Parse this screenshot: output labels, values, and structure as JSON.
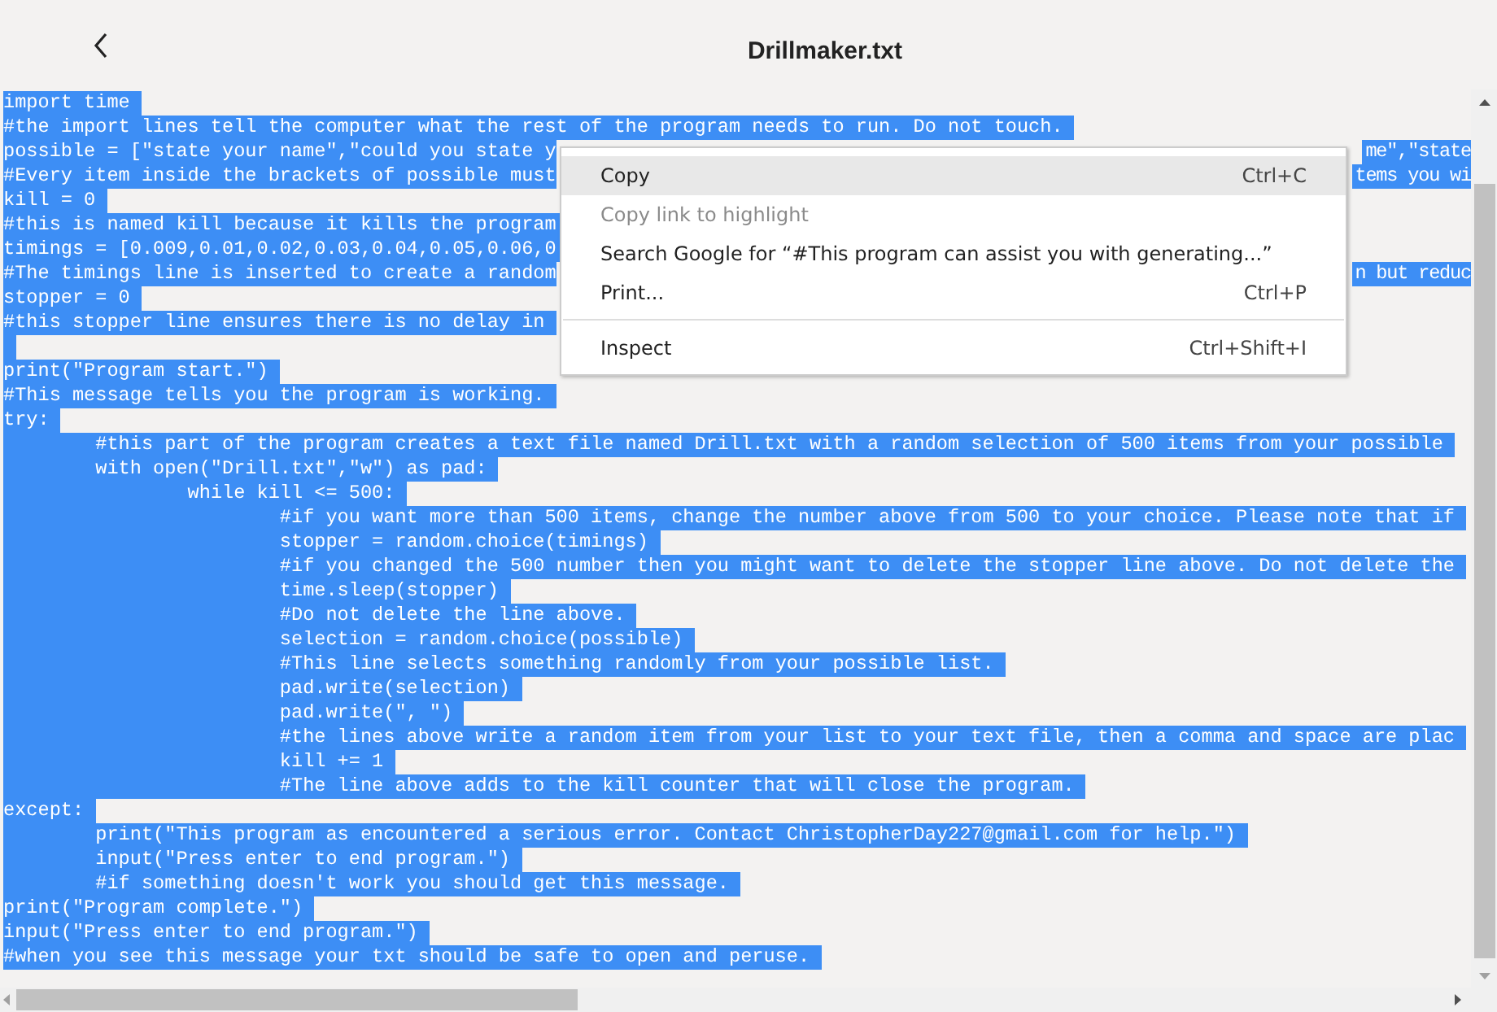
{
  "header": {
    "title": "Drillmaker.txt"
  },
  "lines": [
    {
      "kind": "code",
      "text": "import time",
      "selected": true
    },
    {
      "kind": "code",
      "text": "#the import lines tell the computer what the rest of the program needs to run. Do not touch.",
      "selected": true
    },
    {
      "kind": "code",
      "text": "possible = [\"state your name\",\"could you state y",
      "tail": "me\",\"state",
      "selected": true
    },
    {
      "kind": "code",
      "text": "#Every item inside the brackets of possible must",
      "tail": "tems you wi",
      "selected": true
    },
    {
      "kind": "code",
      "text": "kill = 0",
      "selected": true
    },
    {
      "kind": "code",
      "text": "#this is named kill because it kills the program",
      "selected": true
    },
    {
      "kind": "code",
      "text": "timings = [0.009,0.01,0.02,0.03,0.04,0.05,0.06,0",
      "selected": true
    },
    {
      "kind": "code",
      "text": "#The timings line is inserted to create a random",
      "tail": "n but reduc",
      "selected": true
    },
    {
      "kind": "code",
      "text": "stopper = 0",
      "selected": true
    },
    {
      "kind": "code",
      "text": "#this stopper line ensures there is no delay in",
      "selected": true
    },
    {
      "kind": "blank",
      "selected": true
    },
    {
      "kind": "code",
      "text": "print(\"Program start.\")",
      "selected": true
    },
    {
      "kind": "code",
      "text": "#This message tells you the program is working.",
      "selected": true
    },
    {
      "kind": "code",
      "text": "try:",
      "selected": true
    },
    {
      "kind": "code",
      "text": "\t#this part of the program creates a text file named Drill.txt with a random selection of 500 items from your possible",
      "selected": true
    },
    {
      "kind": "code",
      "text": "\twith open(\"Drill.txt\",\"w\") as pad:",
      "selected": true
    },
    {
      "kind": "code",
      "text": "\t\twhile kill <= 500:",
      "selected": true
    },
    {
      "kind": "code",
      "text": "\t\t\t#if you want more than 500 items, change the number above from 500 to your choice. Please note that if",
      "selected": true
    },
    {
      "kind": "code",
      "text": "\t\t\tstopper = random.choice(timings)",
      "selected": true
    },
    {
      "kind": "code",
      "text": "\t\t\t#if you changed the 500 number then you might want to delete the stopper line above. Do not delete the",
      "selected": true
    },
    {
      "kind": "code",
      "text": "\t\t\ttime.sleep(stopper)",
      "selected": true
    },
    {
      "kind": "code",
      "text": "\t\t\t#Do not delete the line above.",
      "selected": true
    },
    {
      "kind": "code",
      "text": "\t\t\tselection = random.choice(possible)",
      "selected": true
    },
    {
      "kind": "code",
      "text": "\t\t\t#This line selects something randomly from your possible list.",
      "selected": true
    },
    {
      "kind": "code",
      "text": "\t\t\tpad.write(selection)",
      "selected": true
    },
    {
      "kind": "code",
      "text": "\t\t\tpad.write(\", \")",
      "selected": true
    },
    {
      "kind": "code",
      "text": "\t\t\t#the lines above write a random item from your list to your text file, then a comma and space are plac",
      "selected": true
    },
    {
      "kind": "code",
      "text": "\t\t\tkill += 1",
      "selected": true
    },
    {
      "kind": "code",
      "text": "\t\t\t#The line above adds to the kill counter that will close the program.",
      "selected": true
    },
    {
      "kind": "code",
      "text": "except:",
      "selected": true
    },
    {
      "kind": "code",
      "text": "\tprint(\"This program as encountered a serious error. Contact ChristopherDay227@gmail.com for help.\")",
      "selected": true
    },
    {
      "kind": "code",
      "text": "\tinput(\"Press enter to end program.\")",
      "selected": true
    },
    {
      "kind": "code",
      "text": "\t#if something doesn't work you should get this message.",
      "selected": true
    },
    {
      "kind": "code",
      "text": "print(\"Program complete.\")",
      "selected": true
    },
    {
      "kind": "code",
      "text": "input(\"Press enter to end program.\")",
      "selected": true
    },
    {
      "kind": "code",
      "text": "#when you see this message your txt should be safe to open and peruse.",
      "selected": true
    }
  ],
  "menu": {
    "items": [
      {
        "kind": "item",
        "label": "Copy",
        "shortcut": "Ctrl+C",
        "selected": true,
        "disabled": false
      },
      {
        "kind": "item",
        "label": "Copy link to highlight",
        "selected": false,
        "disabled": true
      },
      {
        "kind": "item",
        "label": "Search Google for “#This program can assist you with generating...”",
        "selected": false,
        "disabled": false
      },
      {
        "kind": "item",
        "label": "Print...",
        "shortcut": "Ctrl+P",
        "selected": false,
        "disabled": false
      },
      {
        "kind": "separator"
      },
      {
        "kind": "item",
        "label": "Inspect",
        "shortcut": "Ctrl+Shift+I",
        "selected": false,
        "disabled": false
      }
    ]
  }
}
